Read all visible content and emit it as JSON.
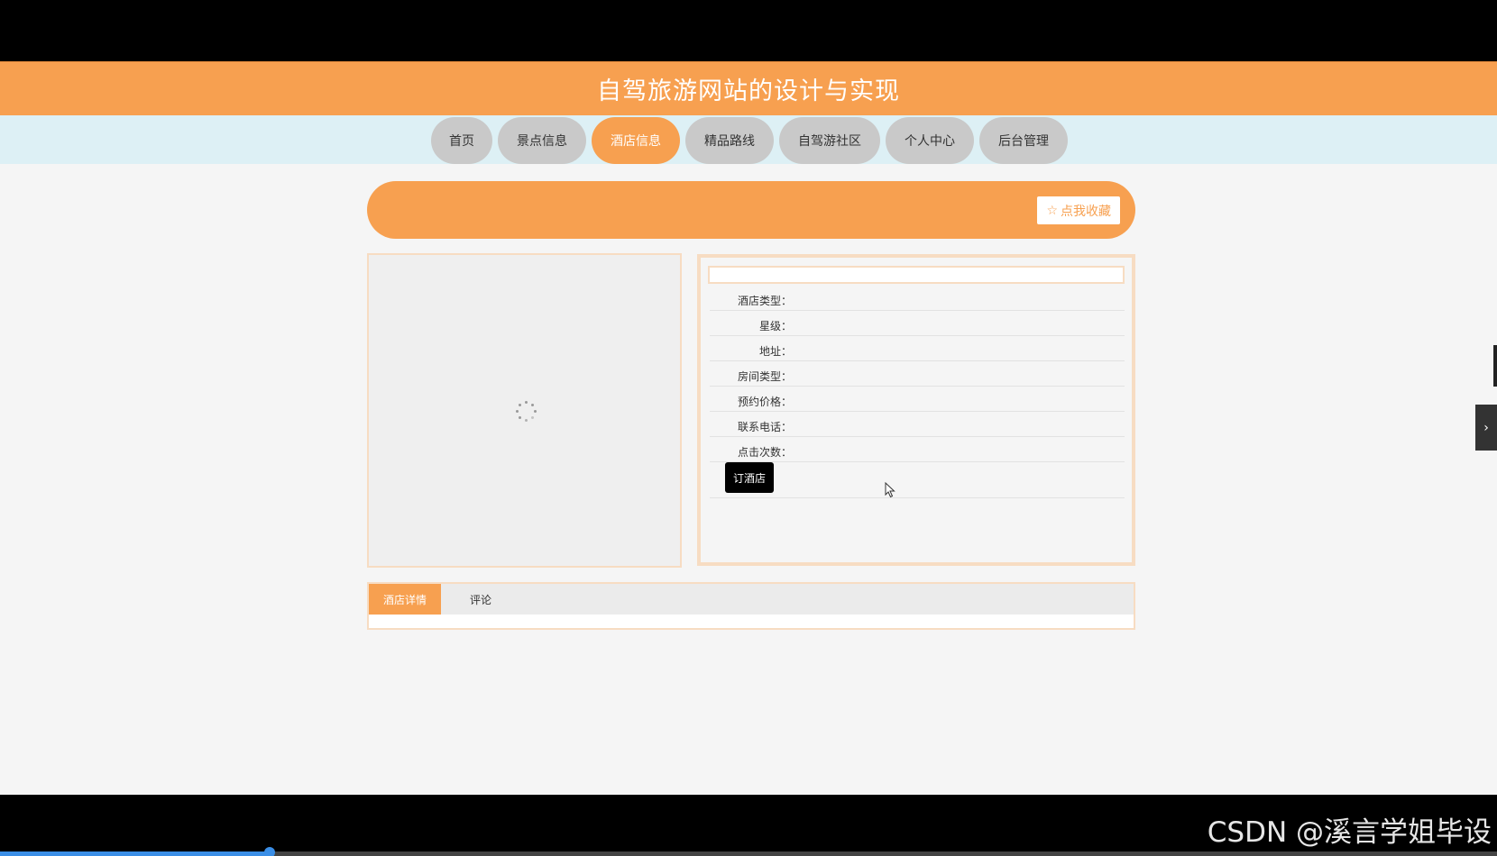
{
  "site": {
    "title": "自驾旅游网站的设计与实现"
  },
  "nav": {
    "items": [
      {
        "label": "首页"
      },
      {
        "label": "景点信息"
      },
      {
        "label": "酒店信息"
      },
      {
        "label": "精品路线"
      },
      {
        "label": "自驾游社区"
      },
      {
        "label": "个人中心"
      },
      {
        "label": "后台管理"
      }
    ],
    "active": "酒店信息"
  },
  "banner": {
    "favorite_label": "点我收藏",
    "favorite_icon": "star-outline-icon"
  },
  "hotel": {
    "name": "",
    "fields": [
      {
        "label": "酒店类型：",
        "value": ""
      },
      {
        "label": "星级：",
        "value": ""
      },
      {
        "label": "地址：",
        "value": ""
      },
      {
        "label": "房间类型：",
        "value": ""
      },
      {
        "label": "预约价格：",
        "value": ""
      },
      {
        "label": "联系电话：",
        "value": ""
      },
      {
        "label": "点击次数：",
        "value": ""
      }
    ],
    "book_label": "订酒店"
  },
  "tabs": {
    "items": [
      {
        "label": "酒店详情"
      },
      {
        "label": "评论"
      }
    ],
    "active": "酒店详情"
  },
  "player": {
    "progress_percent": 18
  },
  "watermark": "CSDN @溪言学姐毕设",
  "colors": {
    "accent": "#f7a050",
    "nav_bg": "#ddf0f5",
    "nav_item": "#c9c9c9",
    "border": "#f7dcc2"
  }
}
